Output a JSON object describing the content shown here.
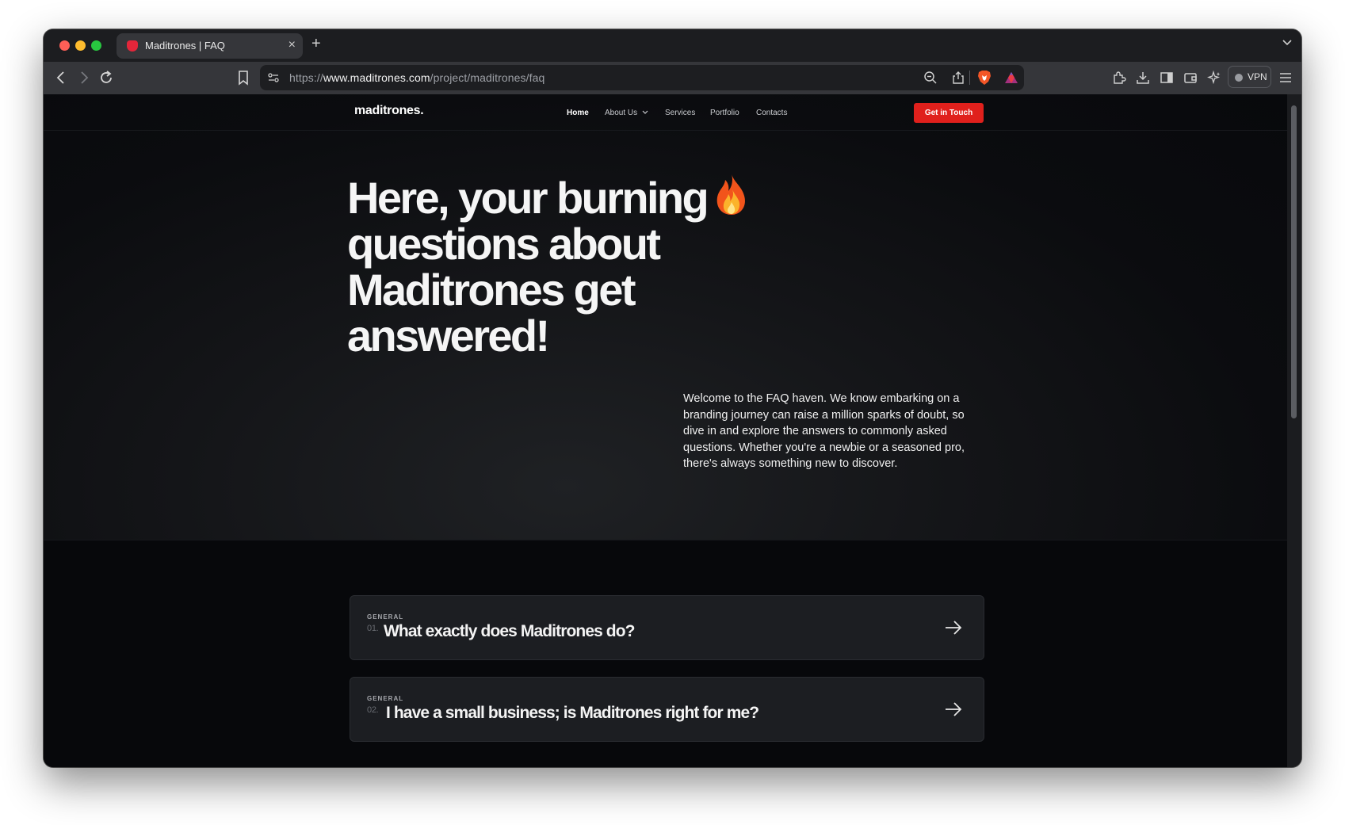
{
  "browser": {
    "tab": {
      "title": "Maditrones | FAQ"
    },
    "url": {
      "prefix": "https://",
      "host": "www.maditrones.com",
      "path": "/project/maditrones/faq"
    },
    "vpn_label": "VPN"
  },
  "site": {
    "logo": "maditrones.",
    "nav": {
      "home": "Home",
      "about": "About Us",
      "services": "Services",
      "portfolio": "Portfolio",
      "contacts": "Contacts"
    },
    "cta": "Get in Touch"
  },
  "hero": {
    "line1": "Here, your burning",
    "line2": "questions about",
    "line3": "Maditrones get",
    "line4": "answered!",
    "intro": "Welcome to the FAQ haven. We know embarking on a branding journey can raise a million sparks of doubt, so dive in and explore the answers to commonly asked questions. Whether you're a newbie or a seasoned pro, there's always something new to discover."
  },
  "faq": [
    {
      "category": "GENERAL",
      "number": "01.",
      "question": "What exactly does Maditrones do?"
    },
    {
      "category": "GENERAL",
      "number": "02.",
      "question": "I have a small business; is Maditrones right for me?"
    }
  ],
  "colors": {
    "accent": "#e0201c",
    "background": "#07080b",
    "card": "#1c1e22"
  }
}
